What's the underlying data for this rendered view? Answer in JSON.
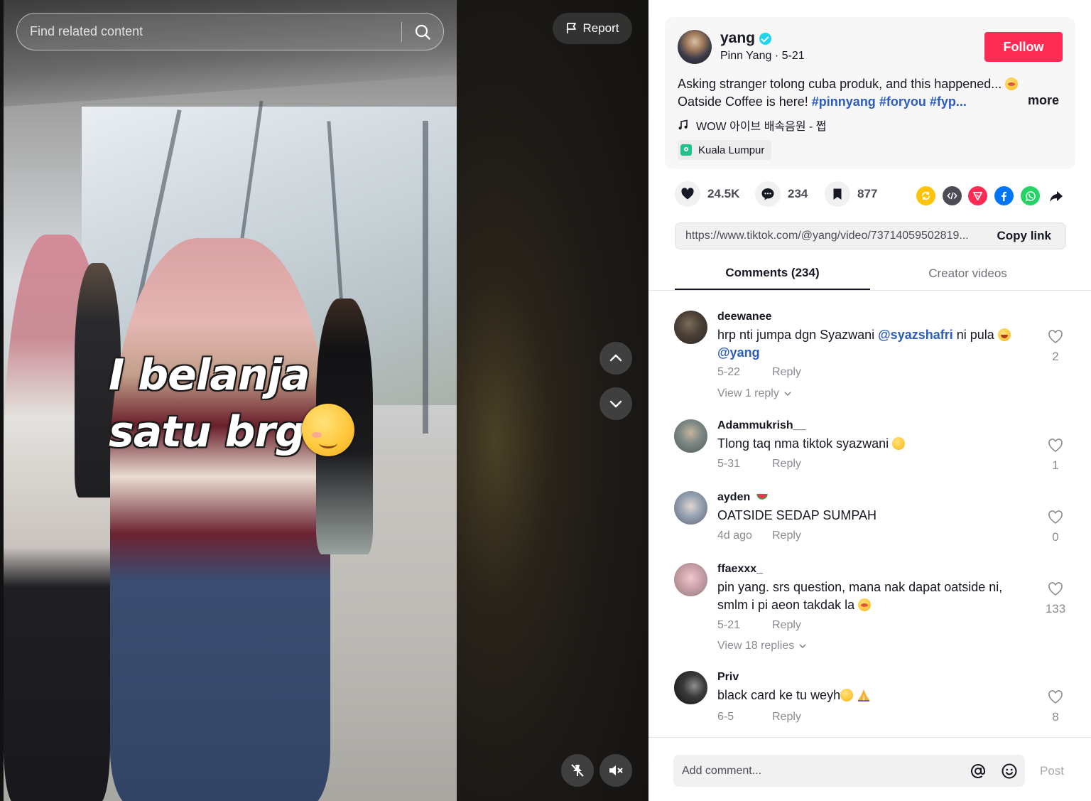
{
  "search": {
    "placeholder": "Find related content"
  },
  "report_label": "Report",
  "video": {
    "caption_line1": "I belanja",
    "caption_line2": "satu brg"
  },
  "author": {
    "username": "yang",
    "display_name": "Pinn Yang",
    "date": "5-21",
    "follow_label": "Follow",
    "description_prefix": "Asking stranger tolong cuba produk, and this happened...",
    "description_line2": "Oatside Coffee is here!",
    "hashtags": [
      "#pinnyang",
      "#foryou",
      "#fyp..."
    ],
    "more_label": "more",
    "music": "WOW 아이브 배속음원 - 쩝",
    "location": "Kuala Lumpur"
  },
  "stats": {
    "likes": "24.5K",
    "comments": "234",
    "saves": "877"
  },
  "share_link": {
    "url": "https://www.tiktok.com/@yang/video/73714059502819...",
    "copy_label": "Copy link"
  },
  "tabs": {
    "comments": "Comments (234)",
    "creator": "Creator videos"
  },
  "comments": [
    {
      "user": "deewanee",
      "text_a": "hrp nti jumpa dgn Syazwani ",
      "mention_a": "@syazshafri",
      "text_b": " ni pula ",
      "mention_b": "@yang",
      "date": "5-22",
      "reply": "Reply",
      "view": "View 1 reply",
      "likes": "2"
    },
    {
      "user": "Adammukrish__",
      "text": "Tlong taq nma tiktok syazwani ",
      "date": "5-31",
      "reply": "Reply",
      "likes": "1"
    },
    {
      "user": "ayden",
      "text": "OATSIDE SEDAP SUMPAH",
      "date": "4d ago",
      "reply": "Reply",
      "likes": "0"
    },
    {
      "user": "ffaexxx_",
      "text": "pin yang. srs question, mana nak dapat oatside ni, smlm i pi aeon takdak la ",
      "date": "5-21",
      "reply": "Reply",
      "view": "View 18 replies",
      "likes": "133"
    },
    {
      "user": "Priv",
      "text": "black card ke tu weyh",
      "date": "6-5",
      "reply": "Reply",
      "likes": "8"
    }
  ],
  "add_comment": {
    "placeholder": "Add comment...",
    "post_label": "Post"
  }
}
